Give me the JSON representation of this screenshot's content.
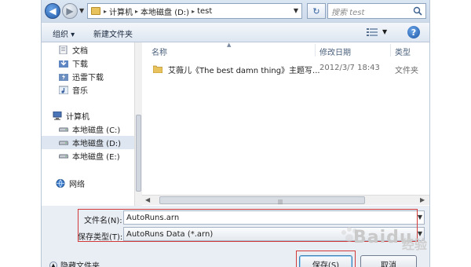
{
  "address_bar": {
    "breadcrumbs": [
      "计算机",
      "本地磁盘 (D:)",
      "test"
    ],
    "search_placeholder": "搜索 test"
  },
  "toolbar": {
    "organize_label": "组织 ▾",
    "new_folder_label": "新建文件夹"
  },
  "nav_pane": {
    "items": [
      {
        "label": "文档",
        "icon": "documents-icon"
      },
      {
        "label": "下载",
        "icon": "downloads-icon"
      },
      {
        "label": "迅雷下载",
        "icon": "thunder-download-icon"
      },
      {
        "label": "音乐",
        "icon": "music-icon"
      },
      {
        "label": "计算机",
        "icon": "computer-icon"
      },
      {
        "label": "本地磁盘 (C:)",
        "icon": "drive-icon"
      },
      {
        "label": "本地磁盘 (D:)",
        "icon": "drive-icon",
        "selected": true
      },
      {
        "label": "本地磁盘 (E:)",
        "icon": "drive-icon"
      },
      {
        "label": "网络",
        "icon": "network-icon"
      }
    ]
  },
  "file_list": {
    "columns": [
      "名称",
      "修改日期",
      "类型"
    ],
    "rows": [
      {
        "name": "艾薇儿《The best damn thing》主题写...",
        "modified": "2012/3/7 18:43",
        "type": "文件夹"
      }
    ]
  },
  "form": {
    "filename_label": "文件名(N):",
    "filename_value": "AutoRuns.arn",
    "filetype_label": "保存类型(T):",
    "filetype_value": "AutoRuns Data (*.arn)",
    "hide_folders_label": "隐藏文件夹",
    "save_label": "保存(S)",
    "cancel_label": "取消"
  },
  "watermark": {
    "text": "Baidu",
    "sub": "经验"
  },
  "colors": {
    "highlight": "#d23a3a",
    "accent": "#1f5aa8"
  }
}
